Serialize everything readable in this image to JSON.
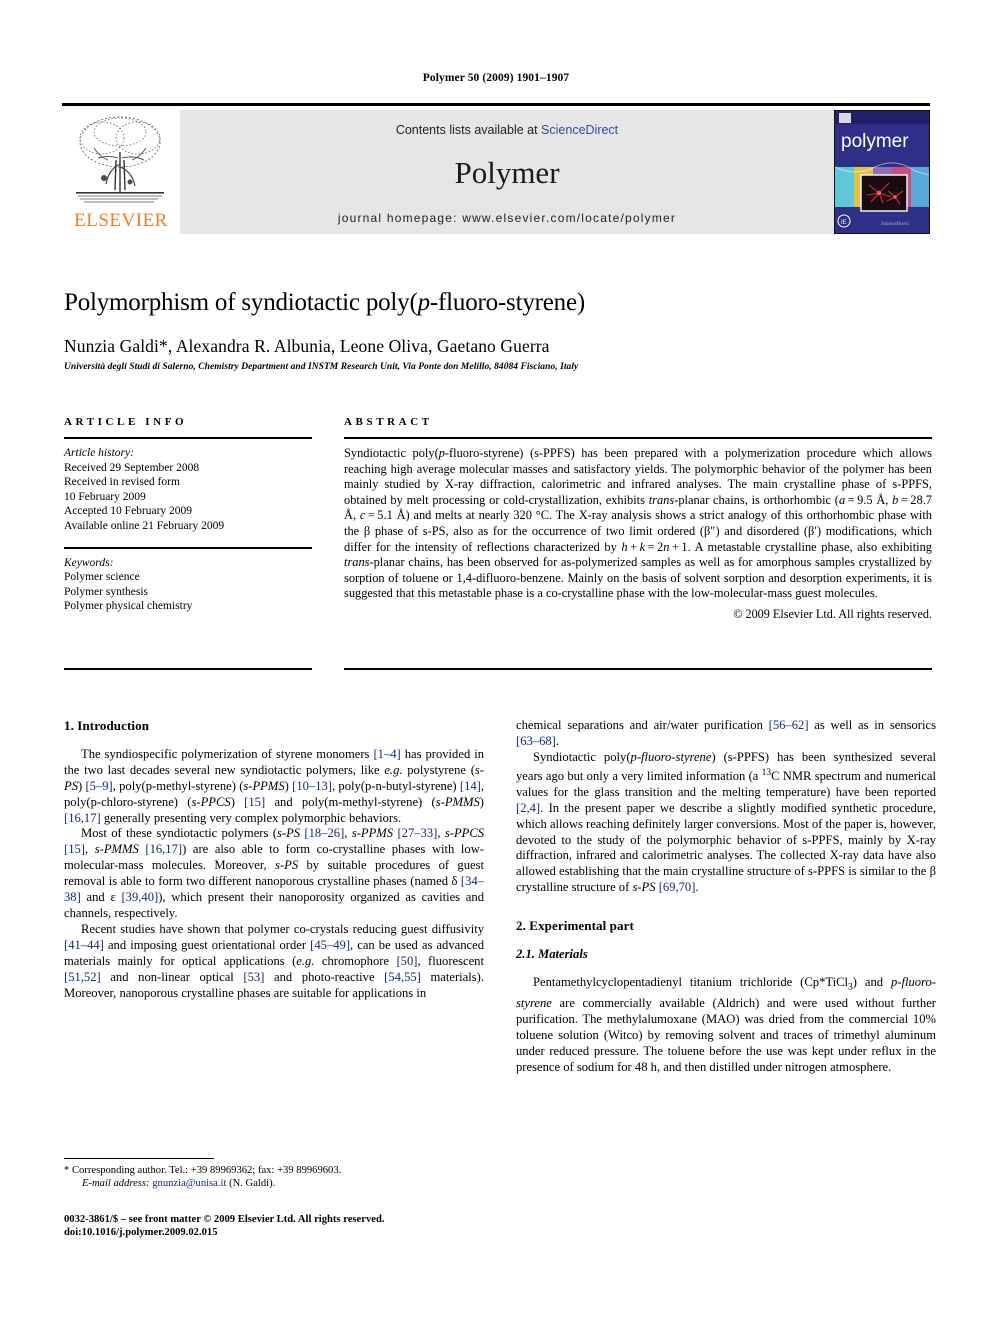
{
  "running_head": "Polymer 50 (2009) 1901–1907",
  "masthead": {
    "publisher": "ELSEVIER",
    "contents_prefix": "Contents lists available at ",
    "sciencedirect": "ScienceDirect",
    "journal": "Polymer",
    "homepage": "journal homepage: www.elsevier.com/locate/polymer",
    "cover_title": "polymer",
    "link_color": "#2b4ea2",
    "elsevier_orange": "#ef7d22"
  },
  "article": {
    "title_part1": "Polymorphism of syndiotactic poly(",
    "title_italic": "p",
    "title_part2": "-fluoro-styrene)",
    "authors": "Nunzia Galdi*, Alexandra R. Albunia, Leone Oliva, Gaetano Guerra",
    "affiliation": "Università degli Studi di Salerno, Chemistry Department and INSTM Research Unit, Via Ponte don Melillo, 84084 Fisciano, Italy"
  },
  "article_info": {
    "label": "ARTICLE INFO",
    "history_label": "Article history:",
    "history": [
      "Received 29 September 2008",
      "Received in revised form",
      "10 February 2009",
      "Accepted 10 February 2009",
      "Available online 21 February 2009"
    ],
    "keywords_label": "Keywords:",
    "keywords": [
      "Polymer science",
      "Polymer synthesis",
      "Polymer physical chemistry"
    ]
  },
  "abstract": {
    "label": "ABSTRACT",
    "text": "Syndiotactic poly(p-fluoro-styrene) (s-PPFS) has been prepared with a polymerization procedure which allows reaching high average molecular masses and satisfactory yields. The polymorphic behavior of the polymer has been mainly studied by X-ray diffraction, calorimetric and infrared analyses. The main crystalline phase of s-PPFS, obtained by melt processing or cold-crystallization, exhibits trans-planar chains, is orthorhombic (a = 9.5 Å, b = 28.7 Å, c = 5.1 Å) and melts at nearly 320 °C. The X-ray analysis shows a strict analogy of this orthorhombic phase with the β phase of s-PS, also as for the occurrence of two limit ordered (β″) and disordered (β′) modifications, which differ for the intensity of reflections characterized by h + k = 2n + 1. A metastable crystalline phase, also exhibiting trans-planar chains, has been observed for as-polymerized samples as well as for amorphous samples crystallized by sorption of toluene or 1,4-difluoro-benzene. Mainly on the basis of solvent sorption and desorption experiments, it is suggested that this metastable phase is a co-crystalline phase with the low-molecular-mass guest molecules.",
    "copyright": "© 2009 Elsevier Ltd. All rights reserved."
  },
  "sections": {
    "introduction_heading": "1. Introduction",
    "experimental_heading": "2. Experimental part",
    "materials_heading": "2.1. Materials"
  },
  "body": {
    "intro_p1": "The syndiospecific polymerization of styrene monomers [1–4] has provided in the two last decades several new syndiotactic polymers, like e.g. polystyrene (s-PS) [5–9], poly(p-methyl-styrene) (s-PPMS) [10–13], poly(p-n-butyl-styrene) [14], poly(p-chloro-styrene) (s-PPCS) [15] and poly(m-methyl-styrene) (s-PMMS) [16,17] generally presenting very complex polymorphic behaviors.",
    "intro_p2": "Most of these syndiotactic polymers (s-PS [18–26], s-PPMS [27–33], s-PPCS [15], s-PMMS [16,17]) are also able to form co-crystalline phases with low-molecular-mass molecules. Moreover, s-PS by suitable procedures of guest removal is able to form two different nanoporous crystalline phases (named δ [34–38] and ε [39,40]), which present their nanoporosity organized as cavities and channels, respectively.",
    "intro_p3": "Recent studies have shown that polymer co-crystals reducing guest diffusivity [41–44] and imposing guest orientational order [45–49], can be used as advanced materials mainly for optical applications (e.g. chromophore [50], fluorescent [51,52] and non-linear optical [53] and photo-reactive [54,55] materials). Moreover, nanoporous crystalline phases are suitable for applications in chemical separations and air/water purification [56–62] as well as in sensorics [63–68].",
    "intro_p4": "Syndiotactic poly(p-fluoro-styrene) (s-PPFS) has been synthesized several years ago but only a very limited information (a 13C NMR spectrum and numerical values for the glass transition and the melting temperature) have been reported [2,4]. In the present paper we describe a slightly modified synthetic procedure, which allows reaching definitely larger conversions. Most of the paper is, however, devoted to the study of the polymorphic behavior of s-PPFS, mainly by X-ray diffraction, infrared and calorimetric analyses. The collected X-ray data have also allowed establishing that the main crystalline structure of s-PPFS is similar to the β crystalline structure of s-PS [69,70].",
    "materials_p1": "Pentamethylcyclopentadienyl titanium trichloride (Cp*TiCl3) and p-fluoro-styrene are commercially available (Aldrich) and were used without further purification. The methylalumoxane (MAO) was dried from the commercial 10% toluene solution (Witco) by removing solvent and traces of trimethyl aluminum under reduced pressure. The toluene before the use was kept under reflux in the presence of sodium for 48 h, and then distilled under nitrogen atmosphere."
  },
  "footnote": {
    "corresponding": "* Corresponding author. Tel.: +39 89969362; fax: +39 89969603.",
    "email_label": "E-mail address:",
    "email": "gnunzia@unisa.it",
    "email_suffix": "(N. Galdi)."
  },
  "imprint": {
    "line1": "0032-3861/$ – see front matter © 2009 Elsevier Ltd. All rights reserved.",
    "line2": "doi:10.1016/j.polymer.2009.02.015"
  }
}
